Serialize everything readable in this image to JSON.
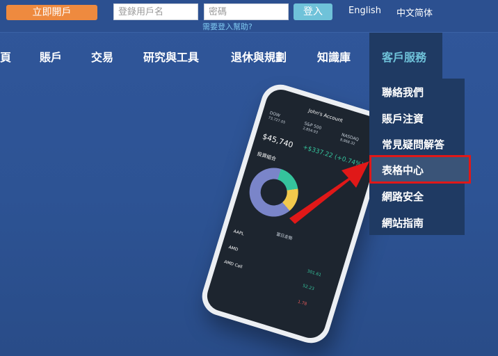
{
  "topbar": {
    "open_account": "立即開戶",
    "username_placeholder": "登錄用戶名",
    "password_placeholder": "密碼",
    "login": "登入",
    "help": "需要登入幫助?",
    "lang_en": "English",
    "lang_zh": "中文简体"
  },
  "nav": {
    "items": [
      "頁",
      "賬戶",
      "交易",
      "研究與工具",
      "退休與規劃",
      "知識庫",
      "客戶服務"
    ]
  },
  "dropdown": {
    "items": [
      "聯絡我們",
      "賬戶注資",
      "常見疑問解答",
      "表格中心",
      "網路安全",
      "網站指南"
    ]
  },
  "phone": {
    "title": "John's Account",
    "dow_label": "DOW",
    "dow_value": "73,727.05",
    "sp_label": "S&P 500",
    "sp_value": "2,854.93",
    "nasdaq_label": "NASDAQ",
    "nasdaq_value": "8,868.32",
    "balance": "$45,740",
    "change": "+$337.22 (+0.74%)",
    "section": "投資組合",
    "watch_label": "當日走勢",
    "aapl": "AAPL",
    "amd": "AMD",
    "amd_price": "301.61",
    "amd_call": "AMD Call",
    "call_price": "52.23",
    "last_price": "1.78"
  },
  "colors": {
    "accent_orange": "#ee8a3f",
    "login_blue": "#6fc2d9",
    "nav_bg": "#2c5090",
    "dropdown_bg": "#1f3a63",
    "highlight_border": "#e01818",
    "arrow": "#e01818"
  }
}
